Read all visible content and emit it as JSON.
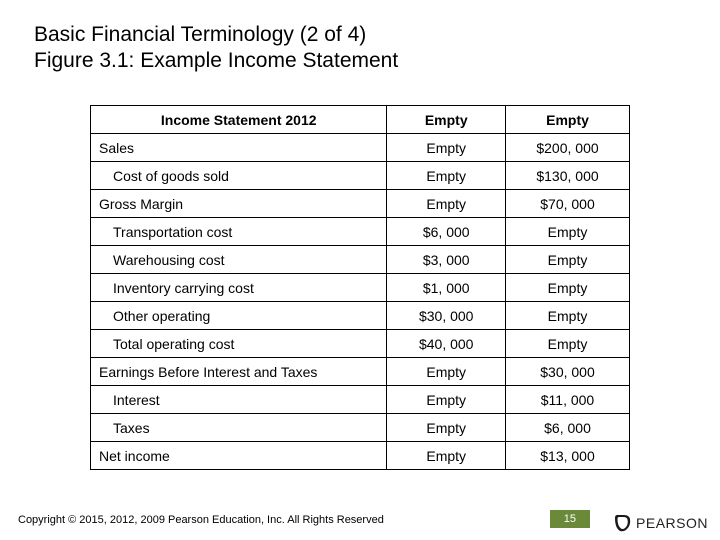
{
  "title_line1": "Basic Financial Terminology (2 of 4)",
  "title_line2": "Figure 3.1: Example Income Statement",
  "table": {
    "header": {
      "c1": "Income Statement 2012",
      "c2": "Empty",
      "c3": "Empty"
    },
    "rows": [
      {
        "label": "Sales",
        "indent": false,
        "c2": "Empty",
        "c3": "$200, 000"
      },
      {
        "label": "Cost of goods sold",
        "indent": true,
        "c2": "Empty",
        "c3": "$130, 000"
      },
      {
        "label": "Gross Margin",
        "indent": false,
        "c2": "Empty",
        "c3": "$70, 000"
      },
      {
        "label": "Transportation cost",
        "indent": true,
        "c2": "$6, 000",
        "c3": "Empty"
      },
      {
        "label": "Warehousing cost",
        "indent": true,
        "c2": "$3, 000",
        "c3": "Empty"
      },
      {
        "label": "Inventory carrying cost",
        "indent": true,
        "c2": "$1, 000",
        "c3": "Empty"
      },
      {
        "label": "Other operating",
        "indent": true,
        "c2": "$30, 000",
        "c3": "Empty"
      },
      {
        "label": "Total operating cost",
        "indent": true,
        "c2": "$40, 000",
        "c3": "Empty"
      },
      {
        "label": "Earnings Before Interest and Taxes",
        "indent": false,
        "c2": "Empty",
        "c3": "$30, 000"
      },
      {
        "label": "Interest",
        "indent": true,
        "c2": "Empty",
        "c3": "$11, 000"
      },
      {
        "label": "Taxes",
        "indent": true,
        "c2": "Empty",
        "c3": "$6, 000"
      },
      {
        "label": "Net income",
        "indent": false,
        "c2": "Empty",
        "c3": "$13, 000"
      }
    ]
  },
  "footer": "Copyright © 2015, 2012, 2009 Pearson Education, Inc. All Rights Reserved",
  "page_number": "15",
  "logo_text": "PEARSON"
}
